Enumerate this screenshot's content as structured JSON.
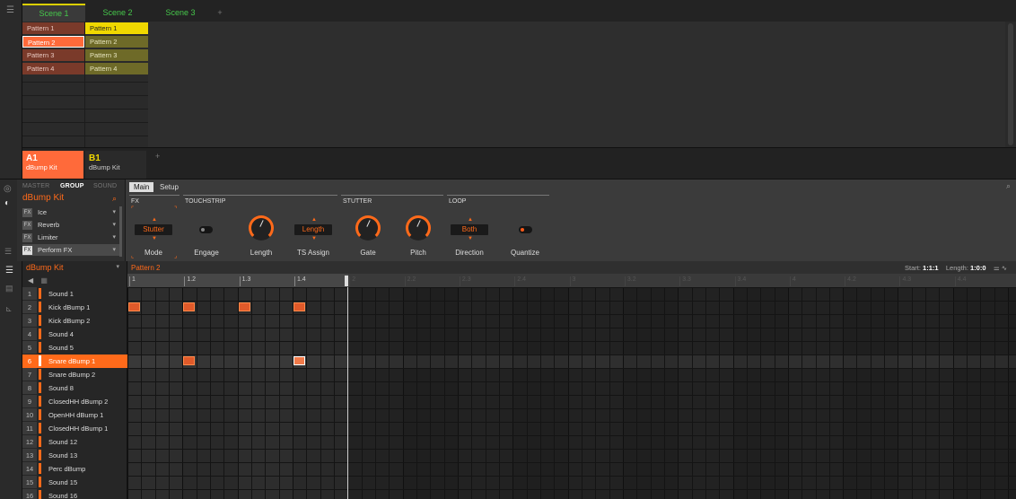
{
  "arranger": {
    "scenes": [
      "Scene 1",
      "Scene 2",
      "Scene 3"
    ],
    "add_scene": "+",
    "col1_patterns": [
      "Pattern 1",
      "Pattern 2",
      "Pattern 3",
      "Pattern 4"
    ],
    "col2_patterns": [
      "Pattern 1",
      "Pattern 2",
      "Pattern 3",
      "Pattern 4"
    ],
    "groups": [
      {
        "id": "A1",
        "name": "dBump Kit"
      },
      {
        "id": "B1",
        "name": "dBump Kit"
      }
    ],
    "add_group": "+"
  },
  "control": {
    "tabs": [
      "MASTER",
      "GROUP",
      "SOUND"
    ],
    "kit_name": "dBump Kit",
    "plugins": [
      {
        "badge": "FX",
        "name": "Ice"
      },
      {
        "badge": "FX",
        "name": "Reverb"
      },
      {
        "badge": "FX",
        "name": "Limiter"
      },
      {
        "badge": "FX",
        "name": "Perform FX"
      }
    ],
    "page_tabs": [
      "Main",
      "Setup"
    ],
    "sections": {
      "fx": "FX",
      "touchstrip": "TOUCHSTRIP",
      "stutter": "STUTTER",
      "loop": "LOOP"
    },
    "mode_value": "Stutter",
    "ts_assign_value": "Length",
    "direction_value": "Both",
    "labels": {
      "mode": "Mode",
      "engage": "Engage",
      "length": "Length",
      "ts_assign": "TS Assign",
      "gate": "Gate",
      "pitch": "Pitch",
      "direction": "Direction",
      "quantize": "Quantize"
    }
  },
  "pattern_editor": {
    "kit_name": "dBump Kit",
    "pattern_name": "Pattern 2",
    "start_label": "Start:",
    "start_value": "1:1:1",
    "length_label": "Length:",
    "length_value": "1:0:0",
    "ruler": [
      "1",
      "1.2",
      "1.3",
      "1.4",
      "2",
      "2.2",
      "2.3",
      "2.4",
      "3",
      "3.2",
      "3.3",
      "3.4",
      "4",
      "4.2",
      "4.3",
      "4.4"
    ],
    "sounds": [
      {
        "num": "1",
        "name": "Sound 1"
      },
      {
        "num": "2",
        "name": "Kick dBump 1"
      },
      {
        "num": "3",
        "name": "Kick dBump 2"
      },
      {
        "num": "4",
        "name": "Sound 4"
      },
      {
        "num": "5",
        "name": "Sound 5"
      },
      {
        "num": "6",
        "name": "Snare dBump 1"
      },
      {
        "num": "7",
        "name": "Snare dBump 2"
      },
      {
        "num": "8",
        "name": "Sound 8"
      },
      {
        "num": "9",
        "name": "ClosedHH dBump 2"
      },
      {
        "num": "10",
        "name": "OpenHH dBump 1"
      },
      {
        "num": "11",
        "name": "ClosedHH dBump 1"
      },
      {
        "num": "12",
        "name": "Sound 12"
      },
      {
        "num": "13",
        "name": "Sound 13"
      },
      {
        "num": "14",
        "name": "Perc dBump"
      },
      {
        "num": "15",
        "name": "Sound 15"
      },
      {
        "num": "16",
        "name": "Sound 16"
      }
    ],
    "selected_sound": 6,
    "notes": [
      {
        "sound": 2,
        "step": 1
      },
      {
        "sound": 2,
        "step": 5
      },
      {
        "sound": 2,
        "step": 9
      },
      {
        "sound": 2,
        "step": 13
      },
      {
        "sound": 6,
        "step": 5
      },
      {
        "sound": 6,
        "step": 13,
        "selected": true
      }
    ],
    "steps_per_pattern": 16
  }
}
